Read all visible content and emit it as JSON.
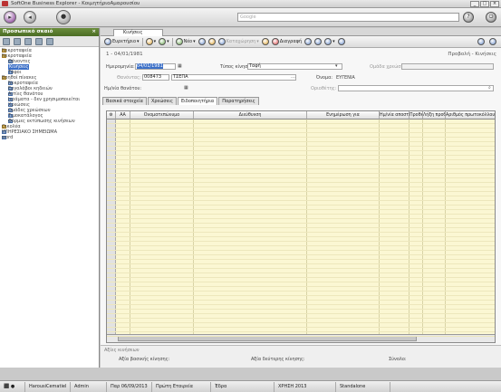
{
  "window": {
    "title": "SoftOne Business Explorer - ΚοιμητήριοΑμαρουσίου"
  },
  "search": {
    "placeholder": "Google"
  },
  "left": {
    "title": "Προσωπικό σκαιό",
    "items": [
      {
        "label": "Νεκροταφεία",
        "type": "folder",
        "indent": 0
      },
      {
        "label": "Νεκροταφεία",
        "type": "folder",
        "indent": 0
      },
      {
        "label": "Θάνοντες",
        "type": "doc",
        "indent": 1
      },
      {
        "label": "Κινήσεις",
        "type": "doc",
        "indent": 1,
        "selected": true
      },
      {
        "label": "Τάφοι",
        "type": "doc",
        "indent": 1
      },
      {
        "label": "Βοηθοί πίνακες",
        "type": "folder",
        "indent": 0
      },
      {
        "label": "Νεκροταφεία",
        "type": "doc",
        "indent": 1
      },
      {
        "label": "Εργολάβοι κηδειών",
        "type": "doc",
        "indent": 1
      },
      {
        "label": "Αιτίες θανάτου",
        "type": "doc",
        "indent": 1
      },
      {
        "label": "Ιεράματα - δεν χρησιμοποιείται",
        "type": "doc",
        "indent": 1
      },
      {
        "label": "Χρεώσεις",
        "type": "doc",
        "indent": 1
      },
      {
        "label": "Ομάδες χρεώσεων",
        "type": "doc",
        "indent": 1
      },
      {
        "label": "Τιμοκατάλογος",
        "type": "doc",
        "indent": 1
      },
      {
        "label": "Φόρμες εκτύπωσης κινήσεων",
        "type": "doc",
        "indent": 1
      },
      {
        "label": "Οικολέα",
        "type": "folder",
        "indent": 0
      },
      {
        "label": "ΥΠΗΡΕΣΙΑΚΟ ΣΗΜΕΙΩΜΑ",
        "type": "doc",
        "indent": 0
      },
      {
        "label": "word",
        "type": "doc",
        "indent": 0
      }
    ]
  },
  "main": {
    "tab": "Κινήσεις",
    "toolbar": {
      "new_label": "Ευρετήριο",
      "new2_label": "Νέο",
      "print_label": "Καταχώρηση",
      "delete_label": "Διαγραφή"
    },
    "record_title": "1 - 04/01/1981",
    "mode": "Προβολή - Κινήσεις",
    "fields": {
      "date_label": "Ημερομηνία:",
      "date_value": "04/01/1981",
      "type_label": "Τύπος κίνησης:",
      "type_value": "Ταφή",
      "group_label": "Ομάδα χρεώσεων:",
      "group_value": "",
      "deceased_label": "Θανόντας:",
      "deceased_code": "008473",
      "deceased_name": "ΤΣΕΠΑ",
      "name_label": "Όνομα:",
      "name_value": "ΕΥΓΕΝΙΑ",
      "death_date_label": "Ημ/νία θανάτου:",
      "death_date_value": "",
      "grave_label": "Οριοθέτης:",
      "grave_value": ""
    },
    "form_tabs": [
      "Βασικά στοιχεία",
      "Χρεώσεις",
      "Ειδοποιητήρια",
      "Παρατηρήσεις"
    ],
    "active_tab": 2,
    "grid_headers": [
      "ΑΑ",
      "Ονοματεπώνυμο",
      "Διεύθυνση",
      "Ενημέρωση για",
      "Ημ/νία αποστολής",
      "Προθεσμία",
      "Λήξη προθεσμίας",
      "Αριθμός πρωτοκόλλου"
    ],
    "footer": {
      "section": "Αξίες κινήσεων",
      "basic_label": "Αξία βασικής κίνησης:",
      "secondary_label": "Αξία δεύτερης κίνησης:",
      "total_label": "Σύνολο:"
    }
  },
  "status": {
    "user": "HarousiCematiel",
    "role": "Admin",
    "date": "Παρ 06/09/2013",
    "company": "Πρώτη Εταιρεία",
    "branch": "Έδρα",
    "year": "ΧΡΗΣΗ 2013",
    "mode": "Standalone"
  },
  "colors": {
    "tree_header": "#5a7d30",
    "grid_bg": "#fbf7d3",
    "select": "#3b6fc7"
  }
}
